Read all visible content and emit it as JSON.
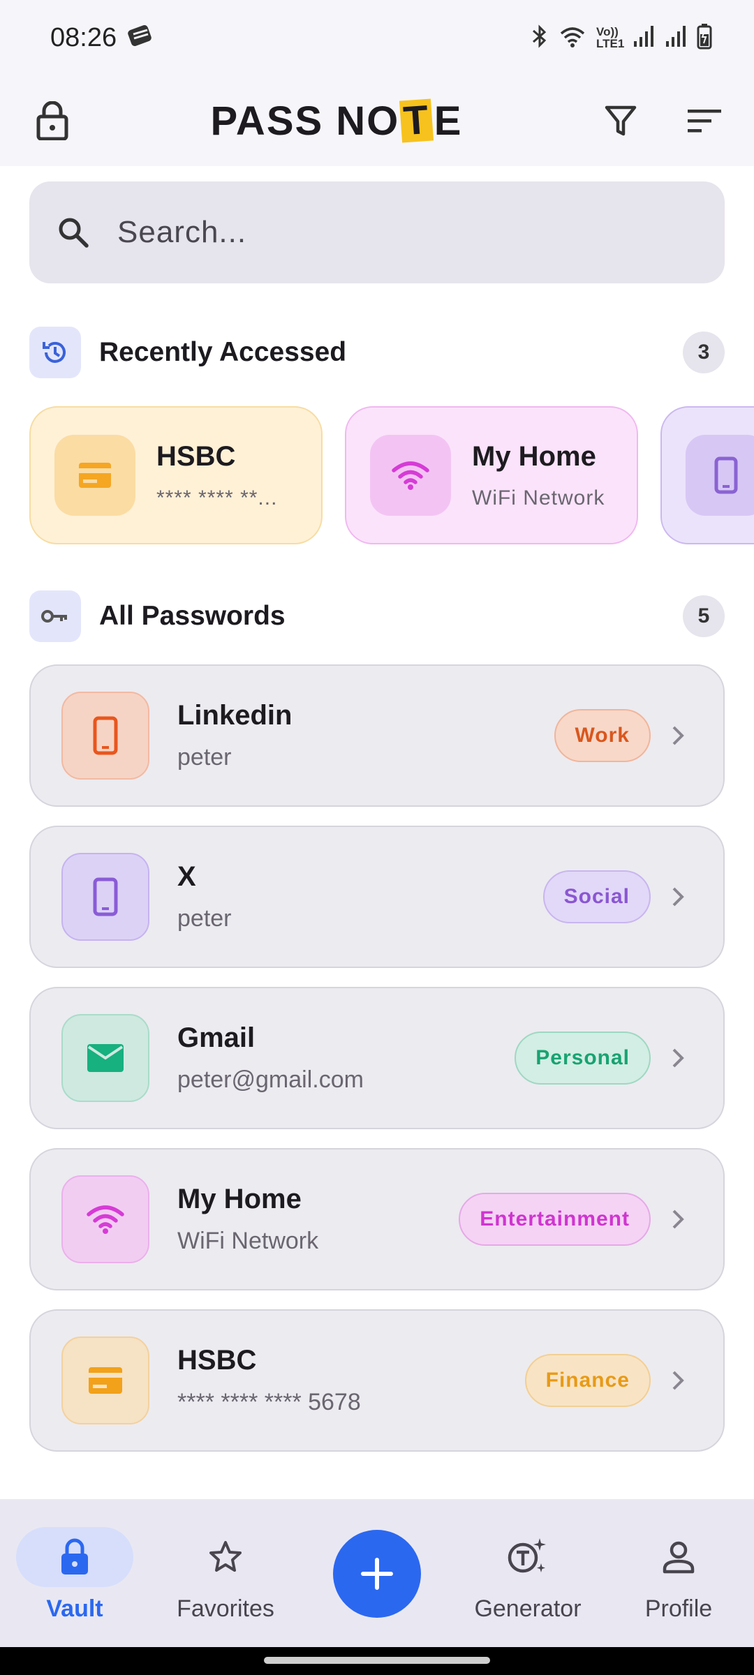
{
  "status_bar": {
    "time": "08:26",
    "network_label": "Vo)) LTE1"
  },
  "header": {
    "logo_part1": "PASS NO",
    "logo_t": "T",
    "logo_part2": "E",
    "lock_icon": "lock-icon",
    "filter_icon": "filter-icon",
    "sort_icon": "sort-icon"
  },
  "search": {
    "placeholder": "Search..."
  },
  "recent": {
    "title": "Recently Accessed",
    "count": "3",
    "items": [
      {
        "title": "HSBC",
        "subtitle": "**** **** **...",
        "icon": "card-icon",
        "color": "#f5a623"
      },
      {
        "title": "My Home",
        "subtitle": "WiFi Network",
        "icon": "wifi-icon",
        "color": "#d63bd6"
      },
      {
        "title": "",
        "subtitle": "",
        "icon": "phone-icon",
        "color": "#8a63d2"
      }
    ]
  },
  "all": {
    "title": "All Passwords",
    "count": "5",
    "items": [
      {
        "title": "Linkedin",
        "subtitle": "peter",
        "tag": "Work",
        "icon": "phone-icon",
        "color": "#e8561e"
      },
      {
        "title": "X",
        "subtitle": "peter",
        "tag": "Social",
        "icon": "phone-icon",
        "color": "#8a5cd6"
      },
      {
        "title": "Gmail",
        "subtitle": "peter@gmail.com",
        "tag": "Personal",
        "icon": "mail-icon",
        "color": "#17b07f"
      },
      {
        "title": "My Home",
        "subtitle": "WiFi Network",
        "tag": "Entertainment",
        "icon": "wifi-icon",
        "color": "#d63bd6"
      },
      {
        "title": "HSBC",
        "subtitle": "**** **** **** 5678",
        "tag": "Finance",
        "icon": "card-icon",
        "color": "#f2a11a"
      }
    ]
  },
  "nav": {
    "vault": "Vault",
    "favorites": "Favorites",
    "generator": "Generator",
    "profile": "Profile",
    "active_color": "#2b68f0"
  }
}
